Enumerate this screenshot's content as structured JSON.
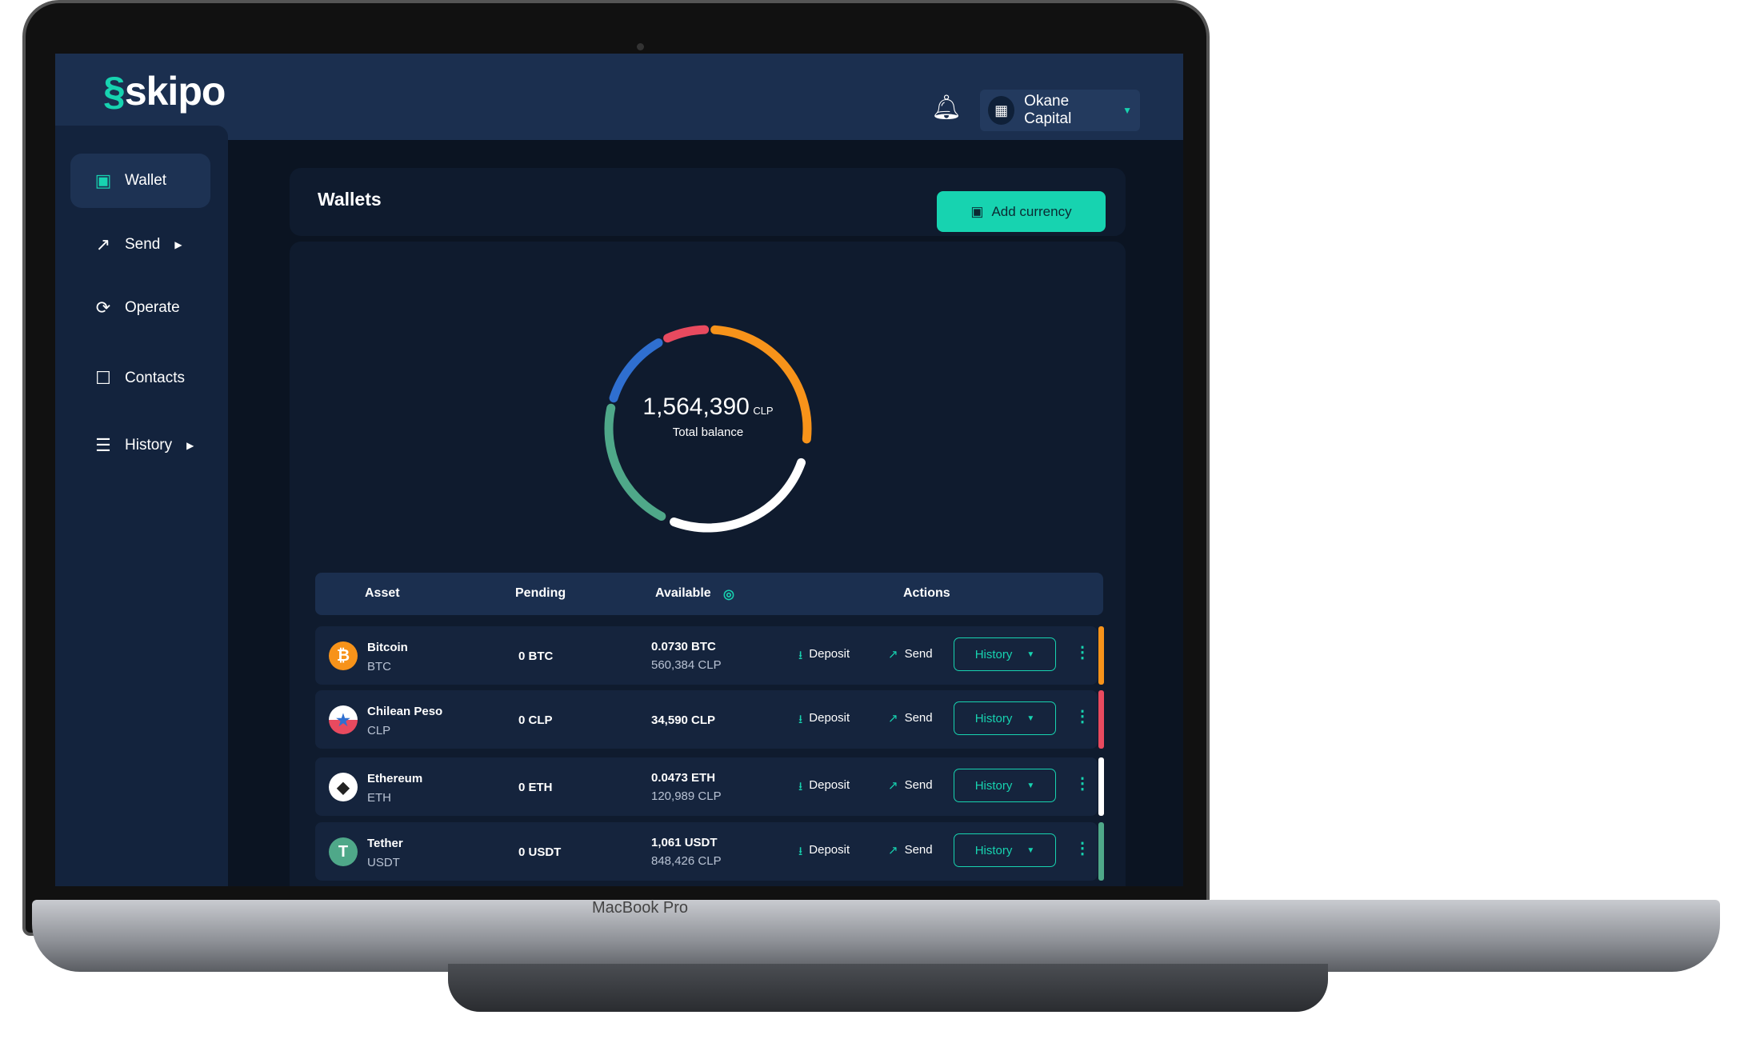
{
  "device": {
    "label": "MacBook Pro"
  },
  "header": {
    "logo": "skipo",
    "bell_icon": "bell-icon",
    "org": {
      "name": "Okane Capital",
      "icon": "building-icon"
    }
  },
  "sidebar": {
    "items": [
      {
        "label": "Wallet",
        "icon": "wallet-icon",
        "active": true
      },
      {
        "label": "Send",
        "icon": "send-arrow-icon",
        "expandable": true
      },
      {
        "label": "Operate",
        "icon": "refresh-icon"
      },
      {
        "label": "Contacts",
        "icon": "contact-card-icon"
      },
      {
        "label": "History",
        "icon": "clipboard-icon",
        "expandable": true
      }
    ]
  },
  "wallets": {
    "title": "Wallets",
    "add_button": "Add currency"
  },
  "balance": {
    "amount": "1,564,390",
    "currency": "CLP",
    "label": "Total balance",
    "segments": [
      {
        "asset": "Bitcoin",
        "color": "#f7931a"
      },
      {
        "asset": "Ethereum",
        "color": "#ffffff"
      },
      {
        "asset": "Tether",
        "color": "#4fa889"
      },
      {
        "asset": "Other",
        "color": "#2f6fd0"
      },
      {
        "asset": "Chilean Peso",
        "color": "#e84a5f"
      }
    ]
  },
  "table": {
    "headers": {
      "asset": "Asset",
      "pending": "Pending",
      "available": "Available",
      "actions": "Actions"
    },
    "deposit_label": "Deposit",
    "send_label": "Send",
    "history_label": "History",
    "rows": [
      {
        "name": "Bitcoin",
        "symbol": "BTC",
        "pending": "0 BTC",
        "available": "0.0730 BTC",
        "available_clp": "560,384 CLP",
        "color": "#f7931a"
      },
      {
        "name": "Chilean Peso",
        "symbol": "CLP",
        "pending": "0 CLP",
        "available": "34,590 CLP",
        "available_clp": "",
        "color": "#e84a5f"
      },
      {
        "name": "Ethereum",
        "symbol": "ETH",
        "pending": "0 ETH",
        "available": "0.0473 ETH",
        "available_clp": "120,989 CLP",
        "color": "#ffffff"
      },
      {
        "name": "Tether",
        "symbol": "USDT",
        "pending": "0 USDT",
        "available": "1,061 USDT",
        "available_clp": "848,426 CLP",
        "color": "#4fa889"
      }
    ]
  }
}
